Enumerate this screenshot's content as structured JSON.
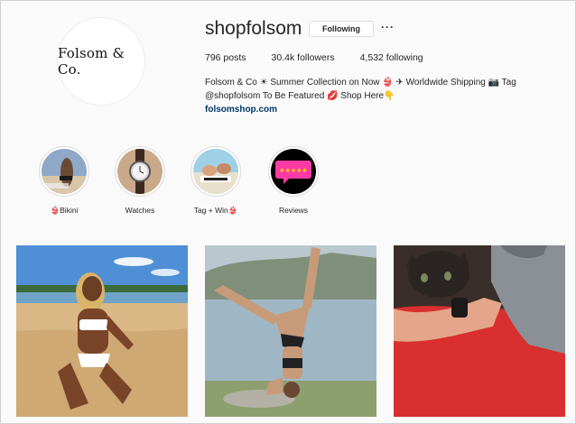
{
  "profile": {
    "avatar_text": "Folsom & Co.",
    "username": "shopfolsom",
    "follow_label": "Following",
    "more_label": "···"
  },
  "stats": {
    "posts": "796 posts",
    "followers": "30.4k followers",
    "following": "4,532 following"
  },
  "bio": {
    "line1": "Folsom & Co ☀ Summer Collection on Now 👙 ✈ Worldwide Shipping 📷 Tag",
    "line2": "@shopfolsom To Be Featured 💋 Shop Here👇",
    "link": "folsomshop.com"
  },
  "highlights": [
    {
      "label": "👙Bikini",
      "icon": "bikini-photo"
    },
    {
      "label": "Watches",
      "icon": "watch-photo"
    },
    {
      "label": "Tag + Win👙",
      "icon": "tag-win-photo"
    },
    {
      "label": "Reviews",
      "icon": "reviews-stars"
    }
  ],
  "colors": {
    "link": "#003569",
    "review_pink": "#ff3aa5",
    "star_yellow": "#ffd400"
  }
}
